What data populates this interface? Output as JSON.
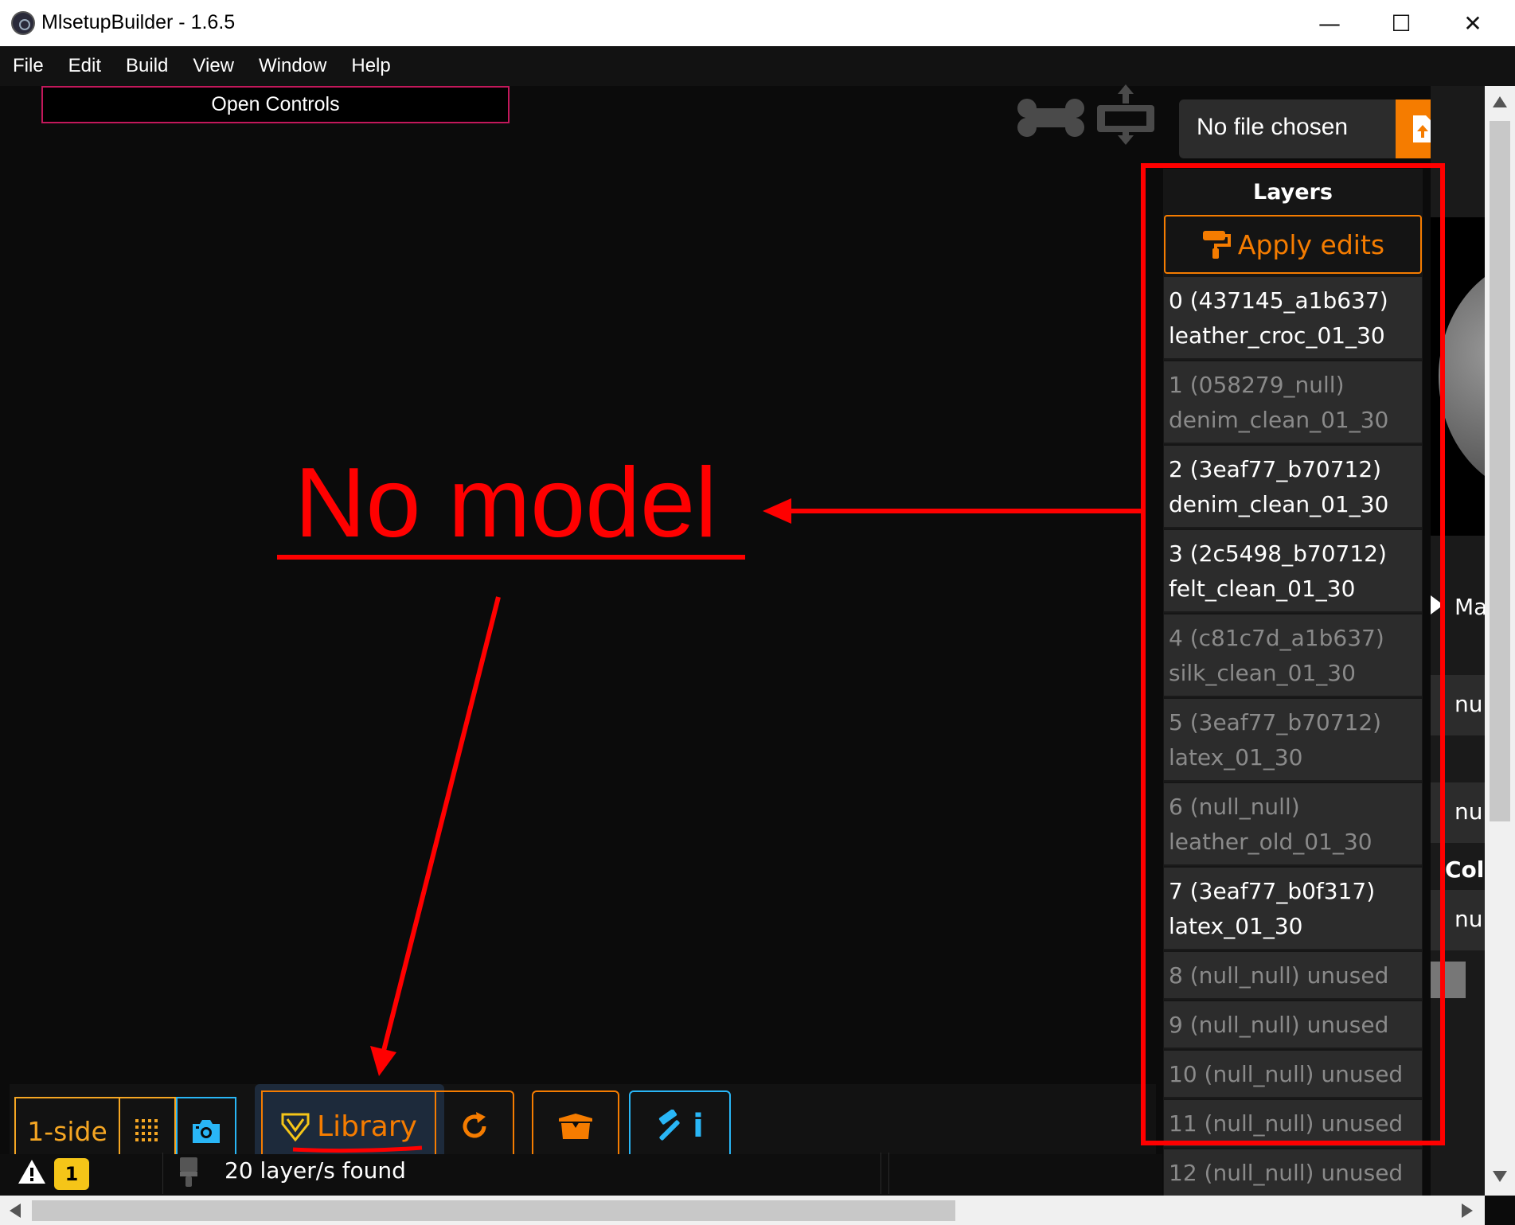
{
  "window": {
    "title": "MlsetupBuilder - 1.6.5",
    "minimize_glyph": "—",
    "maximize_glyph": "☐",
    "close_glyph": "✕"
  },
  "menu": [
    "File",
    "Edit",
    "Build",
    "View",
    "Window",
    "Help"
  ],
  "open_controls_label": "Open Controls",
  "file_input": {
    "label": "No file chosen"
  },
  "layers": {
    "title": "Layers",
    "apply_label": "Apply edits",
    "items": [
      {
        "line1": "0 (437145_a1b637)",
        "line2": "leather_croc_01_30",
        "active": true
      },
      {
        "line1": "1 (058279_null)",
        "line2": "denim_clean_01_30",
        "active": false
      },
      {
        "line1": "2 (3eaf77_b70712)",
        "line2": "denim_clean_01_30",
        "active": true
      },
      {
        "line1": "3 (2c5498_b70712)",
        "line2": "felt_clean_01_30",
        "active": true
      },
      {
        "line1": "4 (c81c7d_a1b637)",
        "line2": "silk_clean_01_30",
        "active": false
      },
      {
        "line1": "5 (3eaf77_b70712)",
        "line2": "latex_01_30",
        "active": false
      },
      {
        "line1": "6 (null_null)",
        "line2": "leather_old_01_30",
        "active": false
      },
      {
        "line1": "7 (3eaf77_b0f317)",
        "line2": "latex_01_30",
        "active": true
      },
      {
        "line1": "8 (null_null) unused",
        "line2": "",
        "active": false
      },
      {
        "line1": "9 (null_null) unused",
        "line2": "",
        "active": false
      },
      {
        "line1": "10 (null_null) unused",
        "line2": "",
        "active": false
      },
      {
        "line1": "11 (null_null) unused",
        "line2": "",
        "active": false
      },
      {
        "line1": "12 (null_null) unused",
        "line2": "",
        "active": false
      }
    ]
  },
  "right_panel": {
    "text_ma": "Ma",
    "text_null_1": "nul",
    "text_null_2": "nul",
    "text_col": "Col",
    "text_null_3": "nul"
  },
  "toolbar": {
    "one_side_label": "1-side",
    "library_label": "Library"
  },
  "status": {
    "warning_count": "1",
    "layers_found": "20 layer/s found"
  },
  "annotation": {
    "text": "No model"
  },
  "colors": {
    "accent_orange": "#f57c00",
    "accent_yellow": "#f5a623",
    "accent_cyan": "#29b6f6",
    "annotation_red": "#ff0000"
  }
}
